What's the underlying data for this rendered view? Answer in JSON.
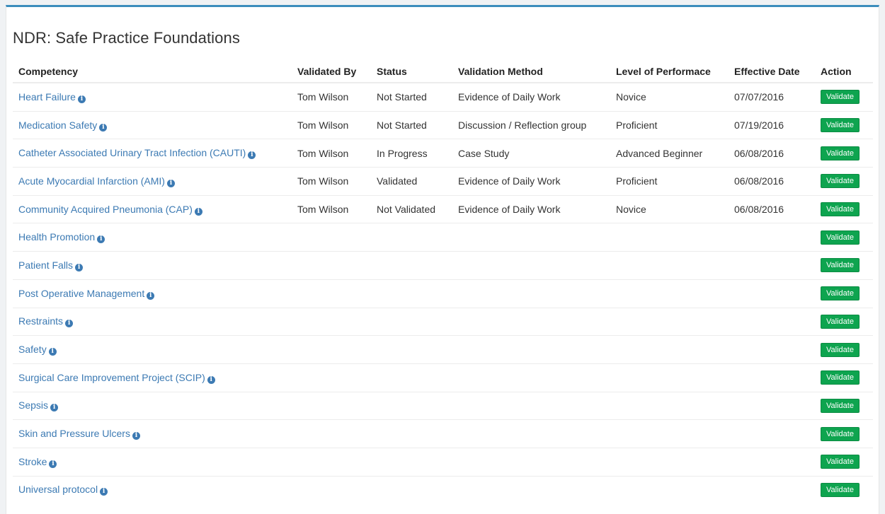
{
  "page": {
    "title": "NDR: Safe Practice Foundations"
  },
  "table": {
    "headers": [
      "Competency",
      "Validated By",
      "Status",
      "Validation Method",
      "Level of Performace",
      "Effective Date",
      "Action"
    ],
    "rows": [
      {
        "competency": "Heart Failure",
        "validated_by": "Tom Wilson",
        "status": "Not Started",
        "method": "Evidence of Daily Work",
        "level": "Novice",
        "date": "07/07/2016",
        "action": "Validate"
      },
      {
        "competency": "Medication Safety",
        "validated_by": "Tom Wilson",
        "status": "Not Started",
        "method": "Discussion / Reflection group",
        "level": "Proficient",
        "date": "07/19/2016",
        "action": "Validate"
      },
      {
        "competency": "Catheter Associated Urinary Tract Infection (CAUTI)",
        "validated_by": "Tom Wilson",
        "status": "In Progress",
        "method": "Case Study",
        "level": "Advanced Beginner",
        "date": "06/08/2016",
        "action": "Validate"
      },
      {
        "competency": "Acute Myocardial Infarction (AMI)",
        "validated_by": "Tom Wilson",
        "status": "Validated",
        "method": "Evidence of Daily Work",
        "level": "Proficient",
        "date": "06/08/2016",
        "action": "Validate"
      },
      {
        "competency": "Community Acquired Pneumonia (CAP)",
        "validated_by": "Tom Wilson",
        "status": "Not Validated",
        "method": "Evidence of Daily Work",
        "level": "Novice",
        "date": "06/08/2016",
        "action": "Validate"
      },
      {
        "competency": "Health Promotion",
        "validated_by": "",
        "status": "",
        "method": "",
        "level": "",
        "date": "",
        "action": "Validate"
      },
      {
        "competency": "Patient Falls",
        "validated_by": "",
        "status": "",
        "method": "",
        "level": "",
        "date": "",
        "action": "Validate"
      },
      {
        "competency": "Post Operative Management",
        "validated_by": "",
        "status": "",
        "method": "",
        "level": "",
        "date": "",
        "action": "Validate"
      },
      {
        "competency": "Restraints",
        "validated_by": "",
        "status": "",
        "method": "",
        "level": "",
        "date": "",
        "action": "Validate"
      },
      {
        "competency": "Safety",
        "validated_by": "",
        "status": "",
        "method": "",
        "level": "",
        "date": "",
        "action": "Validate"
      },
      {
        "competency": "Surgical Care Improvement Project (SCIP)",
        "validated_by": "",
        "status": "",
        "method": "",
        "level": "",
        "date": "",
        "action": "Validate"
      },
      {
        "competency": "Sepsis",
        "validated_by": "",
        "status": "",
        "method": "",
        "level": "",
        "date": "",
        "action": "Validate"
      },
      {
        "competency": "Skin and Pressure Ulcers",
        "validated_by": "",
        "status": "",
        "method": "",
        "level": "",
        "date": "",
        "action": "Validate"
      },
      {
        "competency": "Stroke",
        "validated_by": "",
        "status": "",
        "method": "",
        "level": "",
        "date": "",
        "action": "Validate"
      },
      {
        "competency": "Universal protocol",
        "validated_by": "",
        "status": "",
        "method": "",
        "level": "",
        "date": "",
        "action": "Validate"
      }
    ]
  },
  "icons": {
    "info": "info-circle-icon",
    "info_glyph": "i"
  },
  "colors": {
    "link": "#3c7ab3",
    "validate_button": "#0ea44f",
    "panel_top_border": "#3c8dbc"
  }
}
